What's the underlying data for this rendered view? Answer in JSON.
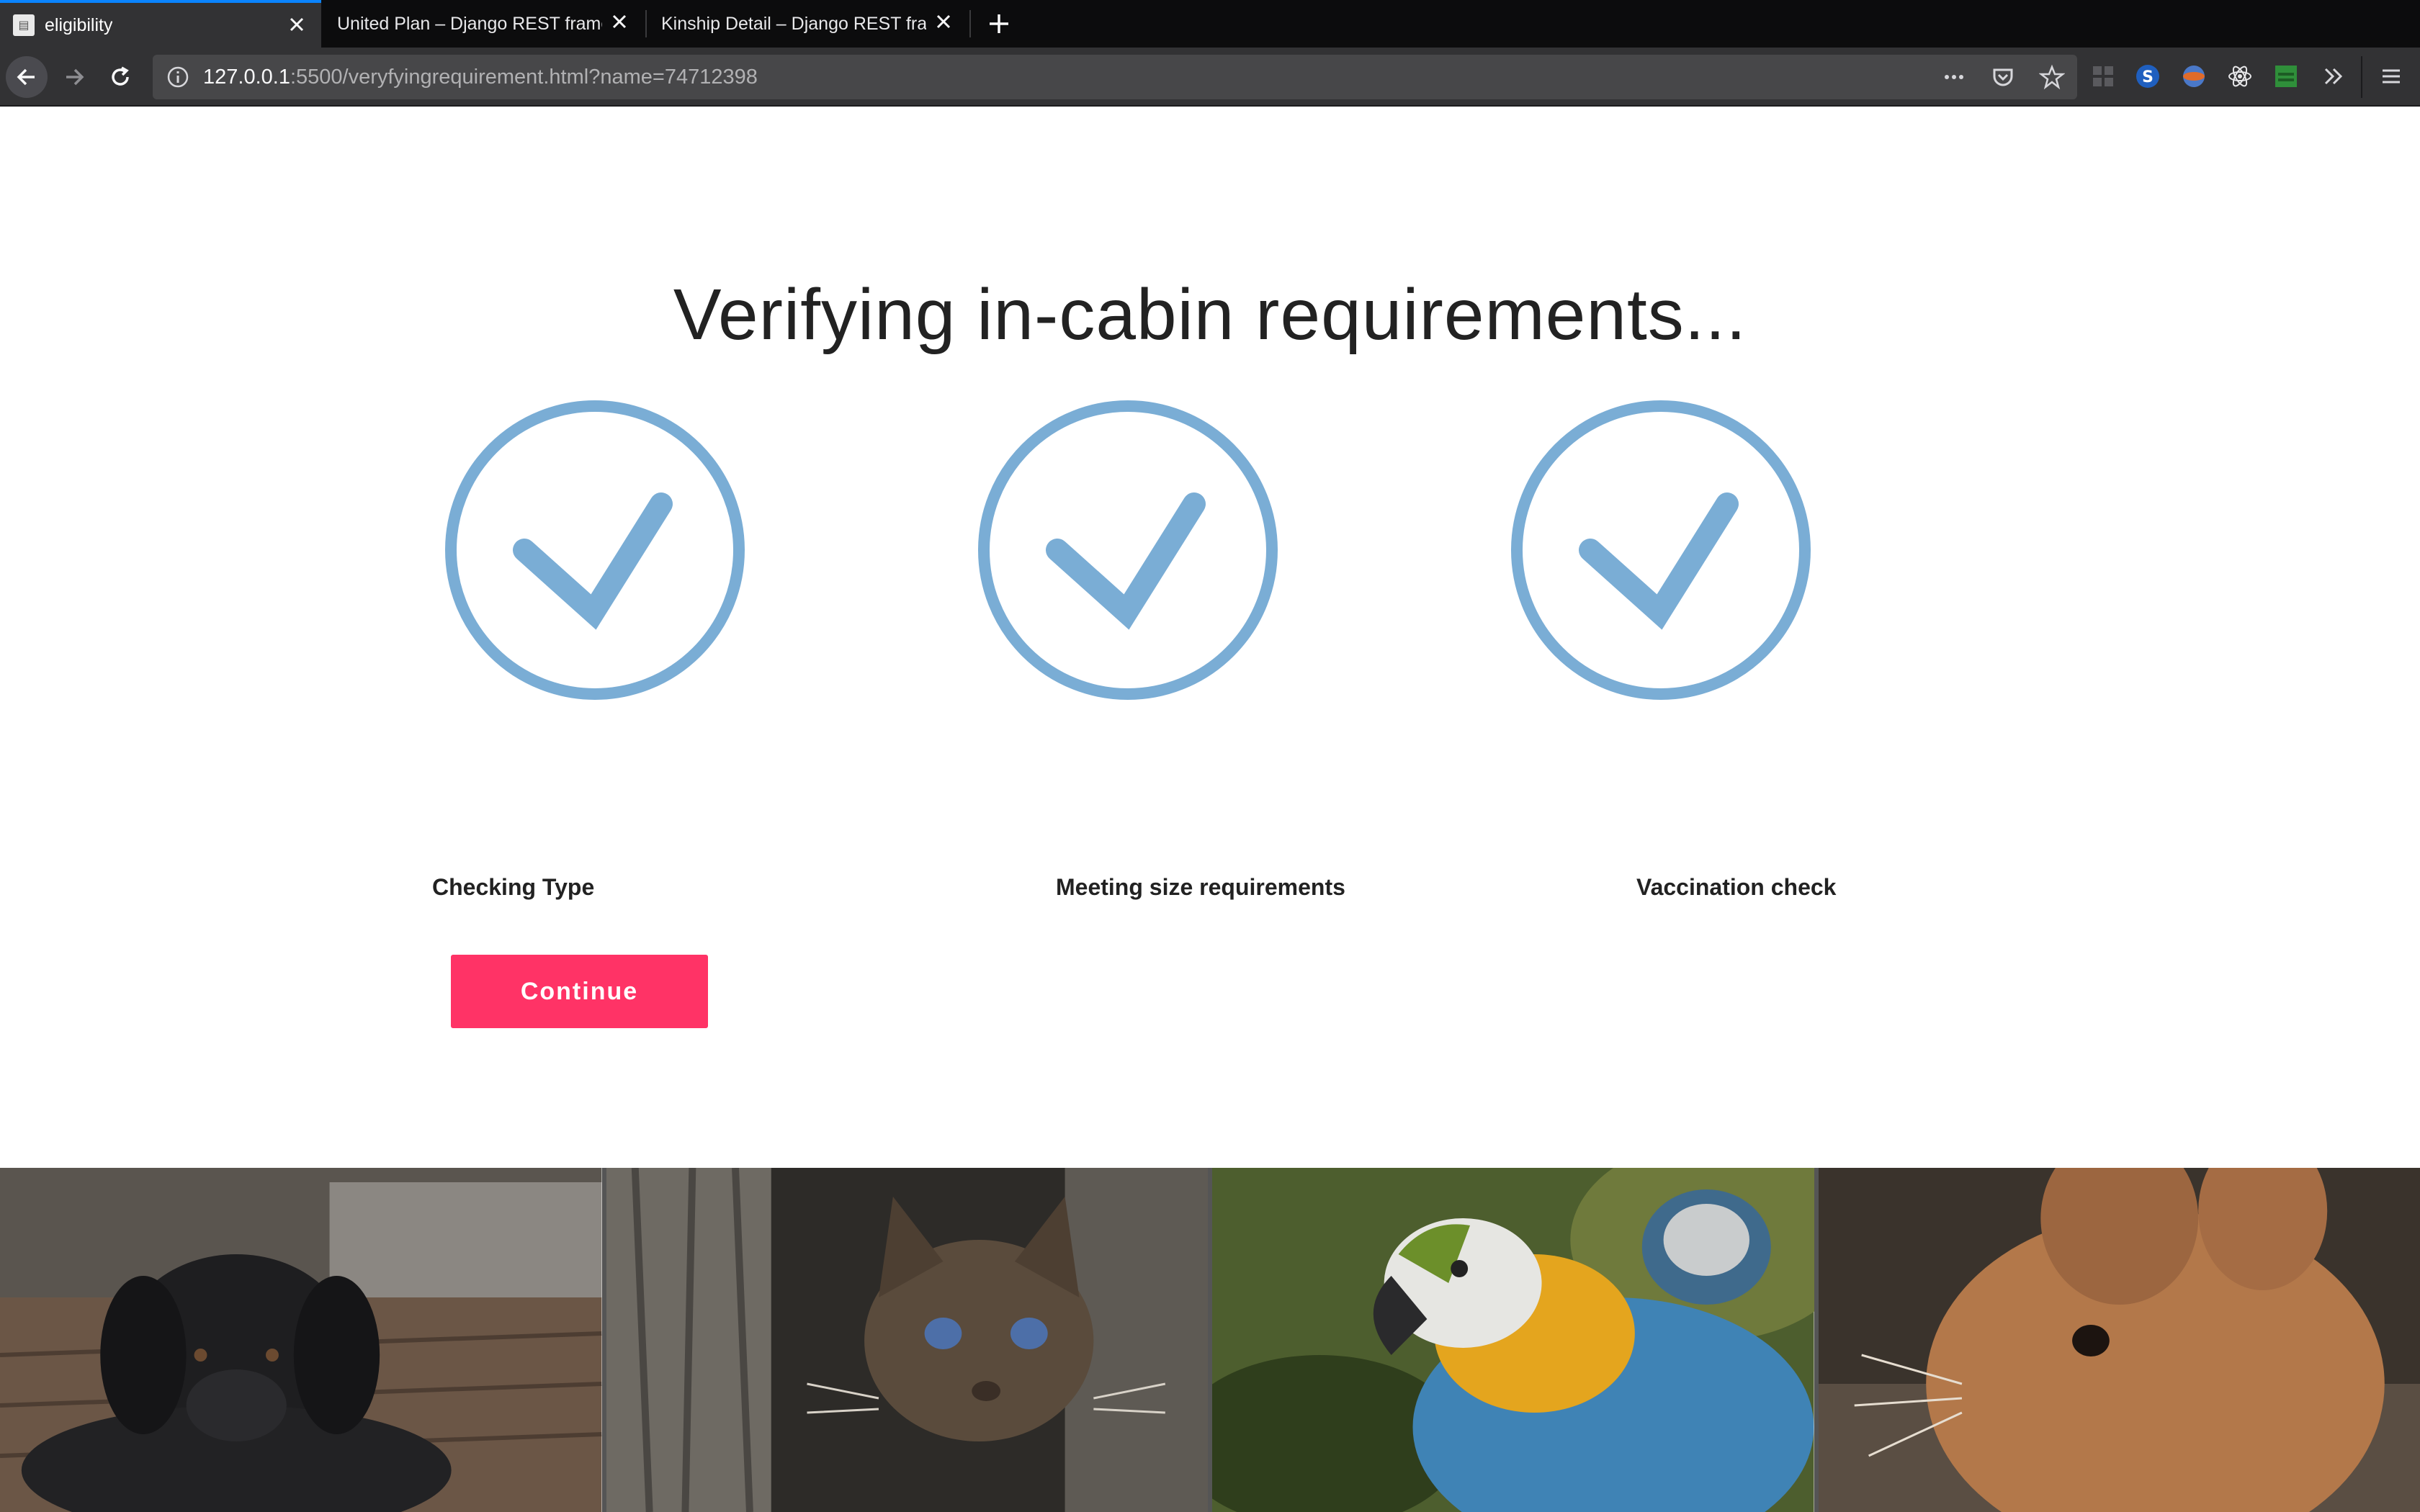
{
  "browser": {
    "tabs": [
      {
        "title": "eligibility",
        "active": true
      },
      {
        "title": "United Plan – Django REST framewo",
        "active": false
      },
      {
        "title": "Kinship Detail – Django REST frame",
        "active": false
      }
    ],
    "url_host": "127.0.0.1",
    "url_rest": ":5500/veryfyingrequirement.html?name=74712398",
    "accent": "#0a84ff"
  },
  "page": {
    "title": "Verifying in-cabin requirements...",
    "checks": [
      {
        "label": "Checking Type",
        "status": "complete"
      },
      {
        "label": "Meeting size requirements",
        "status": "complete"
      },
      {
        "label": "Vaccination check",
        "status": "complete"
      }
    ],
    "check_color": "#7aadd5",
    "continue_label": "Continue",
    "button_color": "#ff3366",
    "gallery": [
      {
        "name": "puppy-photo"
      },
      {
        "name": "kitten-photo"
      },
      {
        "name": "parrot-photo"
      },
      {
        "name": "rabbit-photo"
      }
    ]
  }
}
